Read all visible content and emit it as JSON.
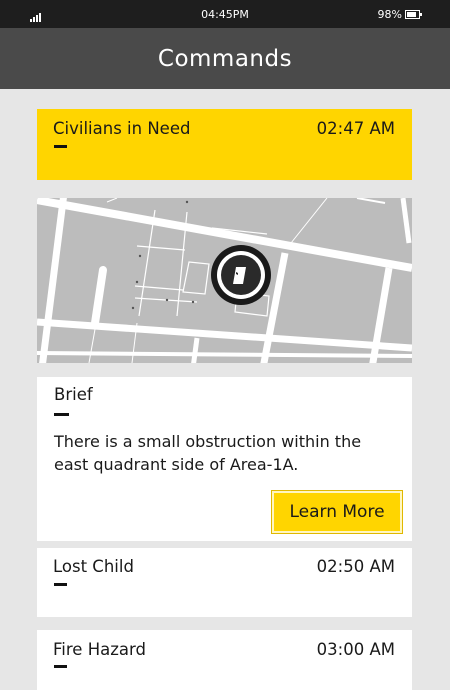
{
  "status_bar": {
    "time": "04:45PM",
    "battery": "98%"
  },
  "header": {
    "title": "Commands"
  },
  "active_command": {
    "title": "Civilians in Need",
    "time": "02:47 AM"
  },
  "brief": {
    "label": "Brief",
    "text": "There is a small obstruction within the east quadrant side of Area-1A.",
    "button_label": "Learn More"
  },
  "commands": [
    {
      "title": "Lost Child",
      "time": "02:50 AM"
    },
    {
      "title": "Fire Hazard",
      "time": "03:00 AM"
    }
  ],
  "icons": [
    "signal-icon",
    "battery-icon",
    "location-marker-icon"
  ],
  "colors": {
    "accent": "#ffd500",
    "header": "#4a4a4a",
    "status_bar": "#1e1e1e",
    "background": "#e6e6e6",
    "map": "#bcbcbc"
  }
}
